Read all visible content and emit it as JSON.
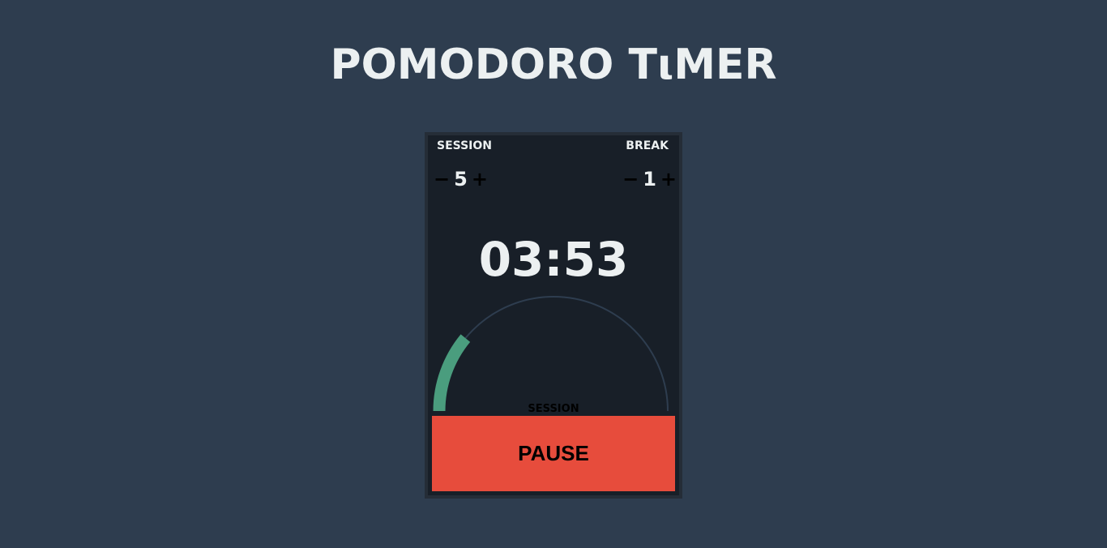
{
  "app": {
    "title": "POMODORO TιMER"
  },
  "settings": {
    "session": {
      "label": "SESSION",
      "decrement": "−",
      "value": "5",
      "increment": "+"
    },
    "break": {
      "label": "BREAK",
      "decrement": "−",
      "value": "1",
      "increment": "+"
    }
  },
  "timer": {
    "time": "03:53",
    "phase": "SESSION",
    "progress": 0.22
  },
  "controls": {
    "pause_label": "PAUSE"
  },
  "colors": {
    "background": "#2e3d4f",
    "card": "#181f28",
    "track": "#2e3d4f",
    "progress": "#4a9d7e",
    "pause": "#e74c3c"
  }
}
